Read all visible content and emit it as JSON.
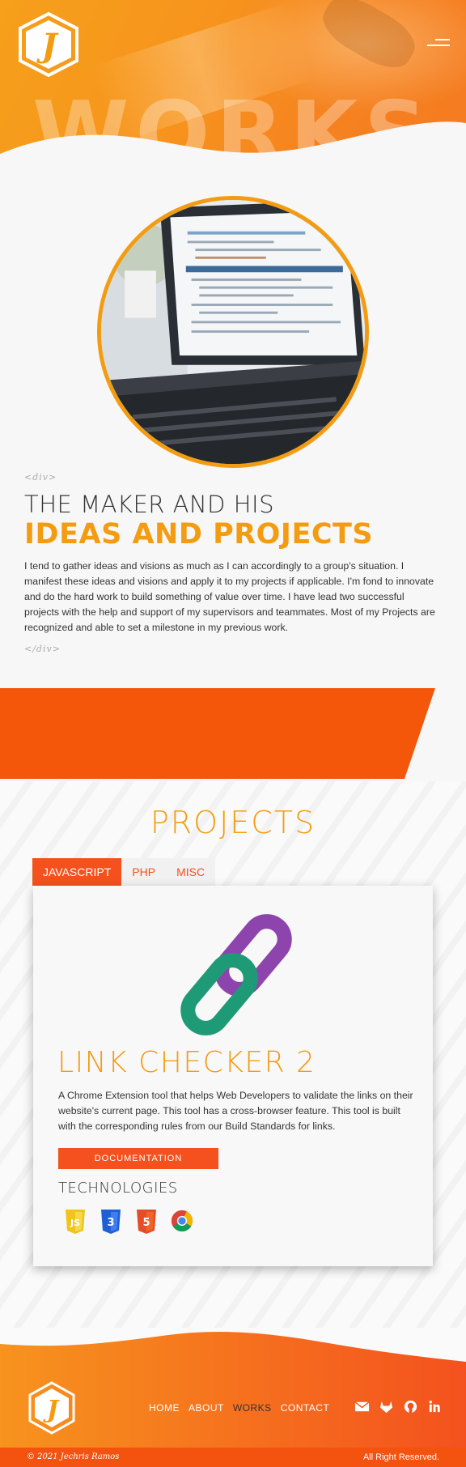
{
  "hero": {
    "background_word": "WORKS",
    "logo_letter": "J"
  },
  "about": {
    "open_tag": "<div>",
    "heading_line1": "THE MAKER AND HIS",
    "heading_line2": "IDEAS AND PROJECTS",
    "paragraph": "I tend to gather ideas and visions as much as I can accordingly to a group's situation. I manifest these ideas and visions and apply it to my projects if applicable. I'm fond to innovate and do the hard work to build something of value over time. I have lead two successful projects with the help and support of my supervisors and teammates. Most of my Projects are recognized and able to set a milestone in my previous work.",
    "close_tag": "</div>"
  },
  "projects": {
    "title": "PROJECTS",
    "tabs": [
      {
        "label": "JAVASCRIPT",
        "active": true
      },
      {
        "label": "PHP",
        "active": false
      },
      {
        "label": "MISC",
        "active": false
      }
    ],
    "card": {
      "icon": "chain-link-icon",
      "title": "LINK CHECKER 2",
      "description": "A Chrome Extension tool that helps Web Developers to validate the links on their website's current page. This tool has a cross-browser feature. This tool is built with the corresponding rules from our Build Standards for links.",
      "button_label": "DOCUMENTATION",
      "technologies_title": "TECHNOLOGIES",
      "technologies": [
        "javascript-icon",
        "css3-icon",
        "html5-icon",
        "chrome-icon"
      ]
    }
  },
  "footer": {
    "logo_letter": "J",
    "nav": [
      {
        "label": "HOME",
        "current": false
      },
      {
        "label": "ABOUT",
        "current": false
      },
      {
        "label": "WORKS",
        "current": true
      },
      {
        "label": "CONTACT",
        "current": false
      }
    ],
    "social": [
      "mail-icon",
      "gitlab-icon",
      "github-icon",
      "linkedin-icon"
    ],
    "copyright": "© 2021 Jechris Ramos",
    "rights": "All Right Reserved."
  },
  "colors": {
    "accent_orange": "#f39c12",
    "accent_red_orange": "#f4511e",
    "banner": "#f4560a"
  }
}
